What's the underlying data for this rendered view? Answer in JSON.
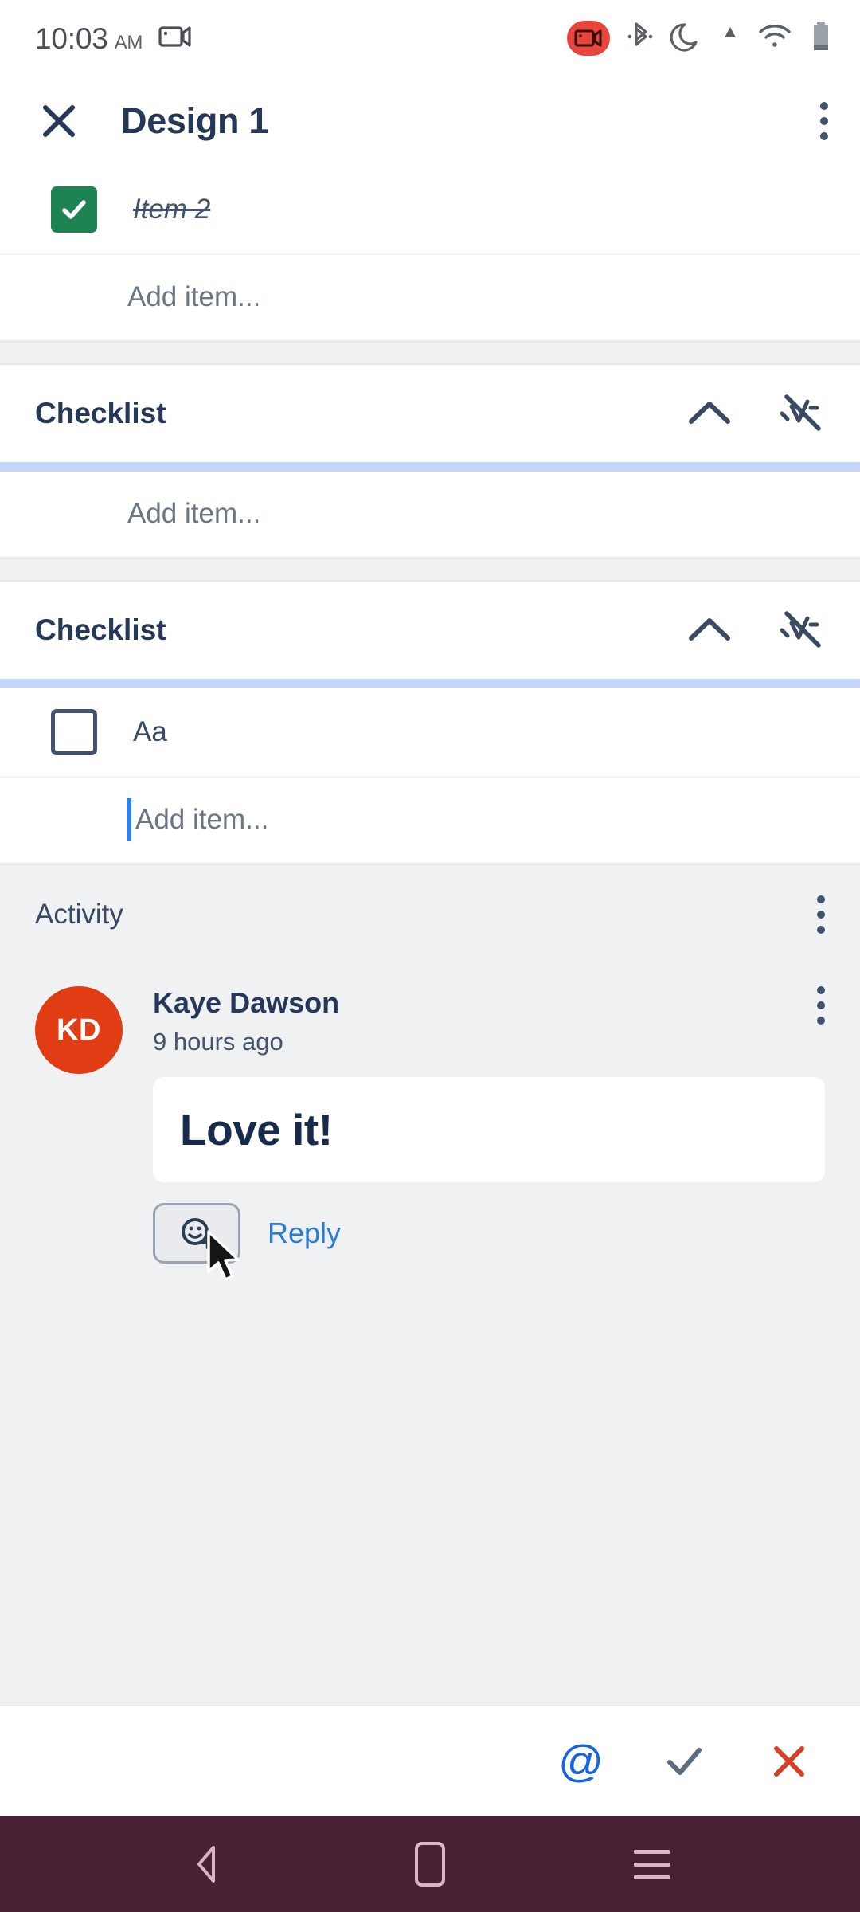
{
  "status_bar": {
    "time": "10:03",
    "ampm": "AM",
    "icons": [
      "screen-record-icon",
      "screen-record-badge-icon",
      "bluetooth-icon",
      "do-not-disturb-moon-icon",
      "signal-icon",
      "wifi-icon",
      "battery-icon"
    ]
  },
  "app_bar": {
    "close_label": "close-icon",
    "title": "Design 1",
    "overflow_label": "more-options-icon"
  },
  "checklist_top": {
    "items": [
      {
        "label": "Item 2",
        "checked": true
      }
    ],
    "add_item_placeholder": "Add item..."
  },
  "sections": [
    {
      "title": "Checklist",
      "collapse_icon": "chevron-up-icon",
      "hide_checked_icon": "hide-checked-items-icon",
      "items": [],
      "add_item_placeholder": "Add item...",
      "add_item_focused": false
    },
    {
      "title": "Checklist",
      "collapse_icon": "chevron-up-icon",
      "hide_checked_icon": "hide-checked-items-icon",
      "items": [
        {
          "label": "Aa",
          "checked": false
        }
      ],
      "add_item_placeholder": "Add item...",
      "add_item_focused": true
    }
  ],
  "activity": {
    "title": "Activity",
    "overflow_label": "more-options-icon",
    "comment": {
      "avatar_initials": "KD",
      "avatar_color": "#e03d15",
      "author": "Kaye Dawson",
      "timestamp": "9 hours ago",
      "text": "Love it!",
      "reaction_button_label": "add-reaction-icon",
      "reply_label": "Reply",
      "reply_color": "#2b7cd3"
    }
  },
  "toolbar": {
    "mention_label": "@",
    "confirm_label": "check-icon",
    "cancel_label": "close-icon",
    "mention_color": "#1565e0",
    "confirm_color": "#5d6b7e",
    "cancel_color": "#d5402b"
  },
  "nav_bar": {
    "back_label": "back-icon",
    "home_label": "home-icon",
    "recents_label": "recents-icon",
    "background": "#4a2235"
  },
  "colors": {
    "checkbox_checked": "#1e8353",
    "section_divider_blue": "#c3d6fa",
    "activity_bg": "#f0f1f3",
    "title_text": "#253858"
  }
}
